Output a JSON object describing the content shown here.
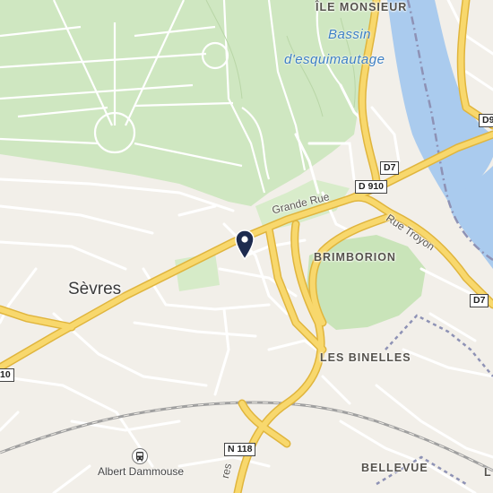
{
  "map": {
    "labels": {
      "ile_monsieur": "ÎLE MONSIEUR",
      "bassin_line1": "Bassin",
      "bassin_line2": "d'esquimautage",
      "sevres": "Sèvres",
      "grande_rue": "Grande Rue",
      "rue_troyon": "Rue Troyon",
      "brimborion": "BRIMBORION",
      "les_binelles": "LES BINELLES",
      "bellevue": "BELLEVUE",
      "albert_dammouse": "Albert Dammouse",
      "edge_left_road": "10",
      "edge_bottom_right": "L",
      "bottom_street_fragment": "res"
    },
    "shields": {
      "d7_top": "D7",
      "d910": "D 910",
      "d7_right": "D7",
      "d9_edge": "D9",
      "n118": "N 118"
    },
    "icons": {
      "marker": "location-pin-icon",
      "transit": "bus-stop-icon"
    },
    "colors": {
      "land": "#f2efe9",
      "park": "#cde6c0",
      "water": "#a9cbef",
      "major_road": "#f7d469",
      "major_road_casing": "#e3b23c",
      "minor_road": "#ffffff",
      "railway": "#9a9a9a",
      "boundary": "#8a8fb0",
      "marker": "#1d2b4f"
    }
  }
}
